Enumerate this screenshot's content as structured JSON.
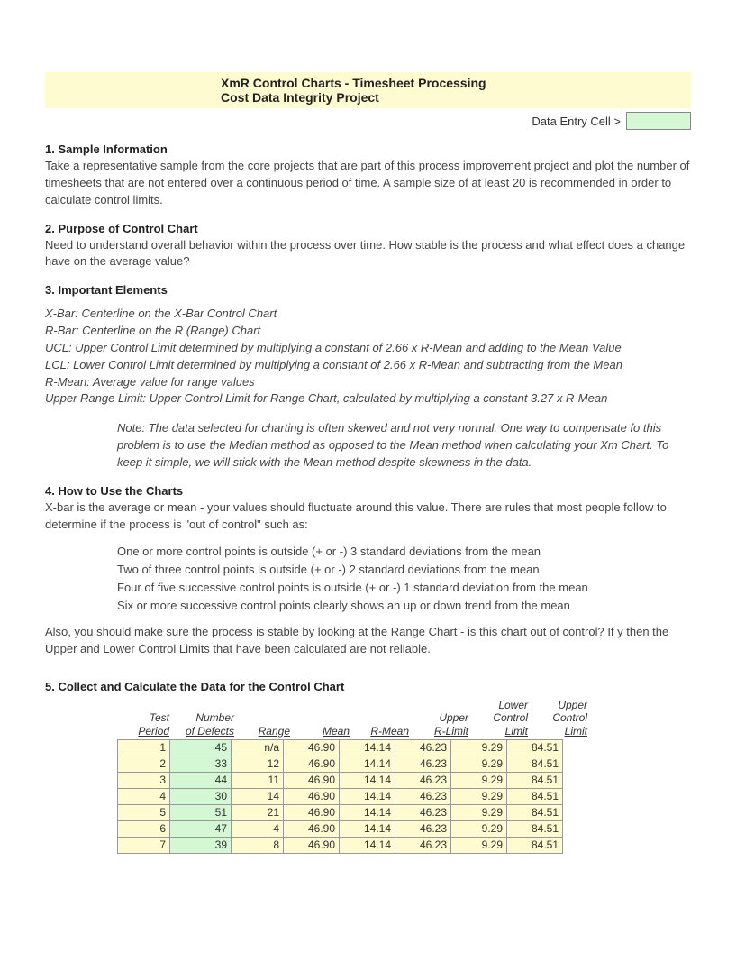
{
  "header": {
    "title_line1": "XmR Control Charts - Timesheet Processing",
    "title_line2": "Cost Data Integrity Project",
    "data_entry_label": "Data Entry Cell >"
  },
  "sections": {
    "s1_h": "1. Sample Information",
    "s1_p": "Take a representative sample from the core projects that are part of this process improvement project and plot the number of timesheets that are not entered over a continuous period of time.  A sample size of at least 20 is recommended in order to calculate control limits.",
    "s2_h": "2. Purpose of Control Chart",
    "s2_p": "Need to understand overall behavior within the process over time. How stable is the process and what effect does a change have on the average value?",
    "s3_h": "3. Important Elements",
    "defs": {
      "d1": "X-Bar: Centerline on the X-Bar Control Chart",
      "d2": "R-Bar: Centerline on the R (Range) Chart",
      "d3": "UCL: Upper Control Limit determined by multiplying a constant of 2.66 x R-Mean and adding to the Mean Value",
      "d4": "LCL: Lower Control Limit determined by multiplying a constant of 2.66 x R-Mean and subtracting from the Mean",
      "d5": "R-Mean: Average value for range values",
      "d6": "Upper Range Limit: Upper Control Limit for Range Chart, calculated by multiplying a constant 3.27 x R-Mean"
    },
    "note": "Note: The data selected for charting is often skewed and not very normal. One way to compensate fo this problem is to use the Median method as opposed to the Mean method when calculating your Xm Chart. To keep it simple, we will stick with the Mean method despite skewness in the data.",
    "s4_h": "4. How to Use the Charts",
    "s4_p1": "X-bar is the average or mean - your values should fluctuate around this value. There are rules that most people follow to determine if the process is \"out of control\" such as:",
    "rules": {
      "r1": "One or more control points is outside (+ or -) 3 standard deviations from the mean",
      "r2": "Two of three control points is outside (+ or -) 2 standard deviations from the mean",
      "r3": "Four of five successive control points is outside (+ or -) 1 standard deviation from the mean",
      "r4": "Six or more successive control points clearly shows an up or down trend from the mean"
    },
    "s4_p2": "Also, you should make sure the process is stable by looking at the Range Chart - is this chart out of control? If y then the Upper and Lower Control Limits that have been calculated are not reliable.",
    "s5_h": "5. Collect and Calculate the Data for the Control Chart"
  },
  "table": {
    "headers": {
      "period_l1": "Test",
      "period_l2": "Period",
      "defects_l1": "Number",
      "defects_l2": "of Defects",
      "range": "Range",
      "mean": "Mean",
      "rmean": "R-Mean",
      "urlimit_l1": "Upper",
      "urlimit_l2": "R-Limit",
      "lcl_l1": "Lower",
      "lcl_l2": "Control",
      "lcl_l3": "Limit",
      "ucl_l1": "Upper",
      "ucl_l2": "Control",
      "ucl_l3": "Limit"
    },
    "rows": [
      {
        "period": "1",
        "defects": "45",
        "range": "n/a",
        "mean": "46.90",
        "rmean": "14.14",
        "urlimit": "46.23",
        "lcl": "9.29",
        "ucl": "84.51"
      },
      {
        "period": "2",
        "defects": "33",
        "range": "12",
        "mean": "46.90",
        "rmean": "14.14",
        "urlimit": "46.23",
        "lcl": "9.29",
        "ucl": "84.51"
      },
      {
        "period": "3",
        "defects": "44",
        "range": "11",
        "mean": "46.90",
        "rmean": "14.14",
        "urlimit": "46.23",
        "lcl": "9.29",
        "ucl": "84.51"
      },
      {
        "period": "4",
        "defects": "30",
        "range": "14",
        "mean": "46.90",
        "rmean": "14.14",
        "urlimit": "46.23",
        "lcl": "9.29",
        "ucl": "84.51"
      },
      {
        "period": "5",
        "defects": "51",
        "range": "21",
        "mean": "46.90",
        "rmean": "14.14",
        "urlimit": "46.23",
        "lcl": "9.29",
        "ucl": "84.51"
      },
      {
        "period": "6",
        "defects": "47",
        "range": "4",
        "mean": "46.90",
        "rmean": "14.14",
        "urlimit": "46.23",
        "lcl": "9.29",
        "ucl": "84.51"
      },
      {
        "period": "7",
        "defects": "39",
        "range": "8",
        "mean": "46.90",
        "rmean": "14.14",
        "urlimit": "46.23",
        "lcl": "9.29",
        "ucl": "84.51"
      }
    ]
  },
  "chart_data": {
    "type": "table",
    "title": "XmR Control Chart Data",
    "columns": [
      "Test Period",
      "Number of Defects",
      "Range",
      "Mean",
      "R-Mean",
      "Upper R-Limit",
      "Lower Control Limit",
      "Upper Control Limit"
    ],
    "rows": [
      [
        1,
        45,
        null,
        46.9,
        14.14,
        46.23,
        9.29,
        84.51
      ],
      [
        2,
        33,
        12,
        46.9,
        14.14,
        46.23,
        9.29,
        84.51
      ],
      [
        3,
        44,
        11,
        46.9,
        14.14,
        46.23,
        9.29,
        84.51
      ],
      [
        4,
        30,
        14,
        46.9,
        14.14,
        46.23,
        9.29,
        84.51
      ],
      [
        5,
        51,
        21,
        46.9,
        14.14,
        46.23,
        9.29,
        84.51
      ],
      [
        6,
        47,
        4,
        46.9,
        14.14,
        46.23,
        9.29,
        84.51
      ],
      [
        7,
        39,
        8,
        46.9,
        14.14,
        46.23,
        9.29,
        84.51
      ]
    ]
  }
}
